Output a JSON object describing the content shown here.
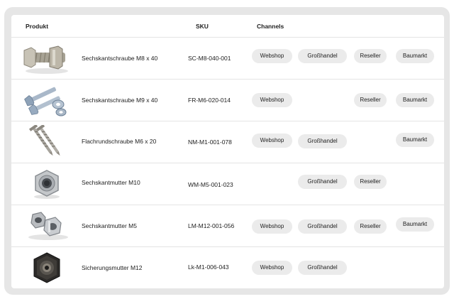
{
  "table": {
    "headers": {
      "product": "Produkt",
      "sku": "SKU",
      "channels": "Channels"
    },
    "rows": [
      {
        "name": "Sechskantschraube M8 x 40",
        "sku": "SC-M8-040-001",
        "image_icon": "hex-bolt-with-nut-icon",
        "channels": {
          "webshop": "Webshop",
          "gross": "Großhandel",
          "reseller": "Reseller",
          "baumarkt": "Baumarkt"
        }
      },
      {
        "name": "Sechskantschraube M9 x 40",
        "sku": "FR-M6-020-014",
        "image_icon": "hex-bolts-and-nuts-icon",
        "channels": {
          "webshop": "Webshop",
          "reseller": "Reseller",
          "baumarkt": "Baumarkt"
        }
      },
      {
        "name": "Flachrundschraube M6 x 20",
        "sku": "NM-M1-001-078",
        "image_icon": "wood-screws-icon",
        "channels": {
          "webshop": "Webshop",
          "gross": "Großhandel",
          "baumarkt": "Baumarkt"
        }
      },
      {
        "name": "Sechskantmutter M10",
        "sku": "WM-M5-001-023",
        "image_icon": "hex-nut-icon",
        "channels": {
          "gross": "Großhandel",
          "reseller": "Reseller"
        }
      },
      {
        "name": "Sechskantmutter M5",
        "sku": "LM-M12-001-056",
        "image_icon": "hex-nuts-pair-icon",
        "channels": {
          "webshop": "Webshop",
          "gross": "Großhandel",
          "reseller": "Reseller",
          "baumarkt": "Baumarkt"
        }
      },
      {
        "name": "Sicherungsmutter M12",
        "sku": "Lk-M1-006-043",
        "image_icon": "lock-nut-icon",
        "channels": {
          "webshop": "Webshop",
          "gross": "Großhandel"
        }
      }
    ]
  }
}
